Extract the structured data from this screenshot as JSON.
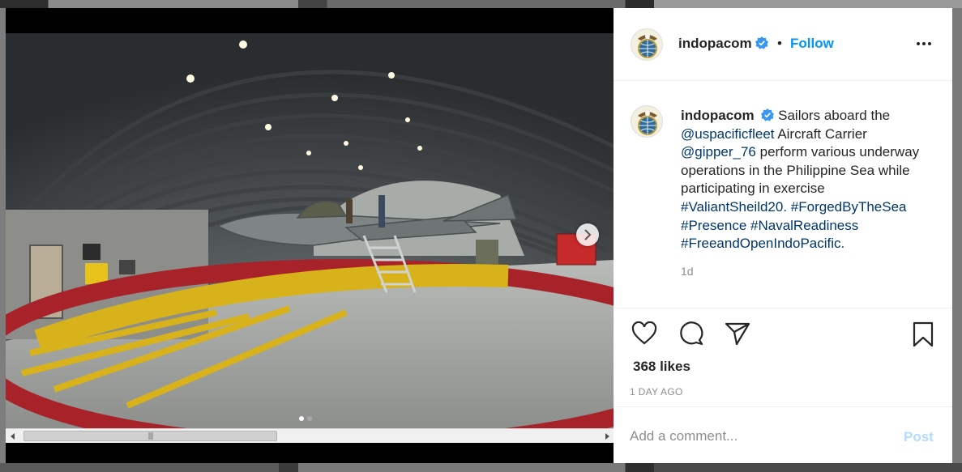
{
  "post": {
    "username": "indopacom",
    "follow_label": "Follow",
    "separator": "•",
    "caption": {
      "username": "indopacom",
      "text_1": " Sailors aboard the ",
      "mention_1": "@uspacificfleet",
      "text_2": " Aircraft Carrier ",
      "mention_2": "@gipper_76",
      "text_3": " perform various underway operations in the Philippine Sea while participating in exercise ",
      "hashtags": [
        "#ValiantSheild20.",
        "#ForgedByTheSea",
        "#Presence",
        "#NavalReadiness",
        "#FreeandOpenIndoPacific."
      ],
      "time": "1d"
    },
    "likes": "368 likes",
    "date": "1 DAY AGO",
    "comment": {
      "placeholder": "Add a comment...",
      "post_label": "Post"
    }
  },
  "carousel": {
    "slide_count": 2,
    "active_index": 0
  },
  "icons": {
    "verified": "verified-badge-icon",
    "more": "more-options-icon",
    "like": "heart-icon",
    "comment": "comment-bubble-icon",
    "share": "paper-plane-icon",
    "save": "bookmark-icon",
    "next": "chevron-right-icon"
  },
  "colors": {
    "accent": "#0095f6",
    "link": "#00376b",
    "text": "#262626",
    "muted": "#8e8e8e",
    "post_disabled": "#b3dbff"
  }
}
